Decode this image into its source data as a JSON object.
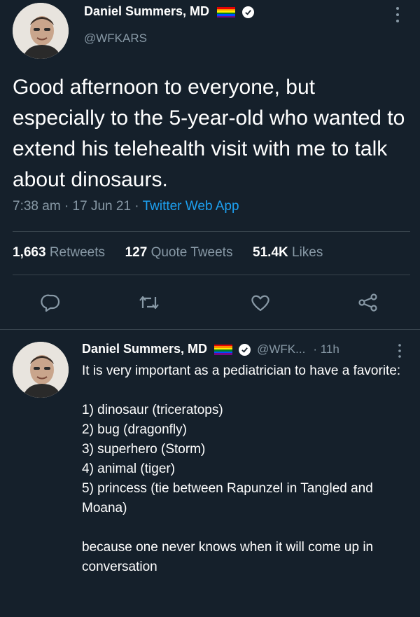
{
  "tweet": {
    "author_name": "Daniel Summers, MD",
    "handle": "@WFKARS",
    "text": "Good afternoon to everyone, but especially to the 5-year-old who wanted to extend his telehealth visit with me to talk about dinosaurs.",
    "time": "7:38 am",
    "date": "17 Jun 21",
    "source": "Twitter Web App",
    "separator": "·",
    "stats": {
      "retweets_count": "1,663",
      "retweets_label": "Retweets",
      "quotes_count": "127",
      "quotes_label": "Quote Tweets",
      "likes_count": "51.4K",
      "likes_label": "Likes"
    }
  },
  "reply": {
    "author_name": "Daniel Summers, MD",
    "handle": "@WFK...",
    "age": "· 11h",
    "intro": "It is very important as a pediatrician to have a favorite:",
    "list": [
      "1) dinosaur (triceratops)",
      "2) bug (dragonfly)",
      "3) superhero (Storm)",
      "4) animal (tiger)",
      "5) princess (tie between Rapunzel in Tangled and Moana)"
    ],
    "closing": "because one never knows when it will come up in conversation"
  },
  "icons": {
    "more": "more-vertical-icon",
    "reply": "reply-icon",
    "retweet": "retweet-icon",
    "like": "heart-icon",
    "share": "share-icon",
    "verified": "verified-badge-icon",
    "flag": "rainbow-flag-icon"
  },
  "colors": {
    "background": "#15202b",
    "secondary_text": "#8899a6",
    "link": "#1da1f2",
    "divider": "#38444d"
  }
}
